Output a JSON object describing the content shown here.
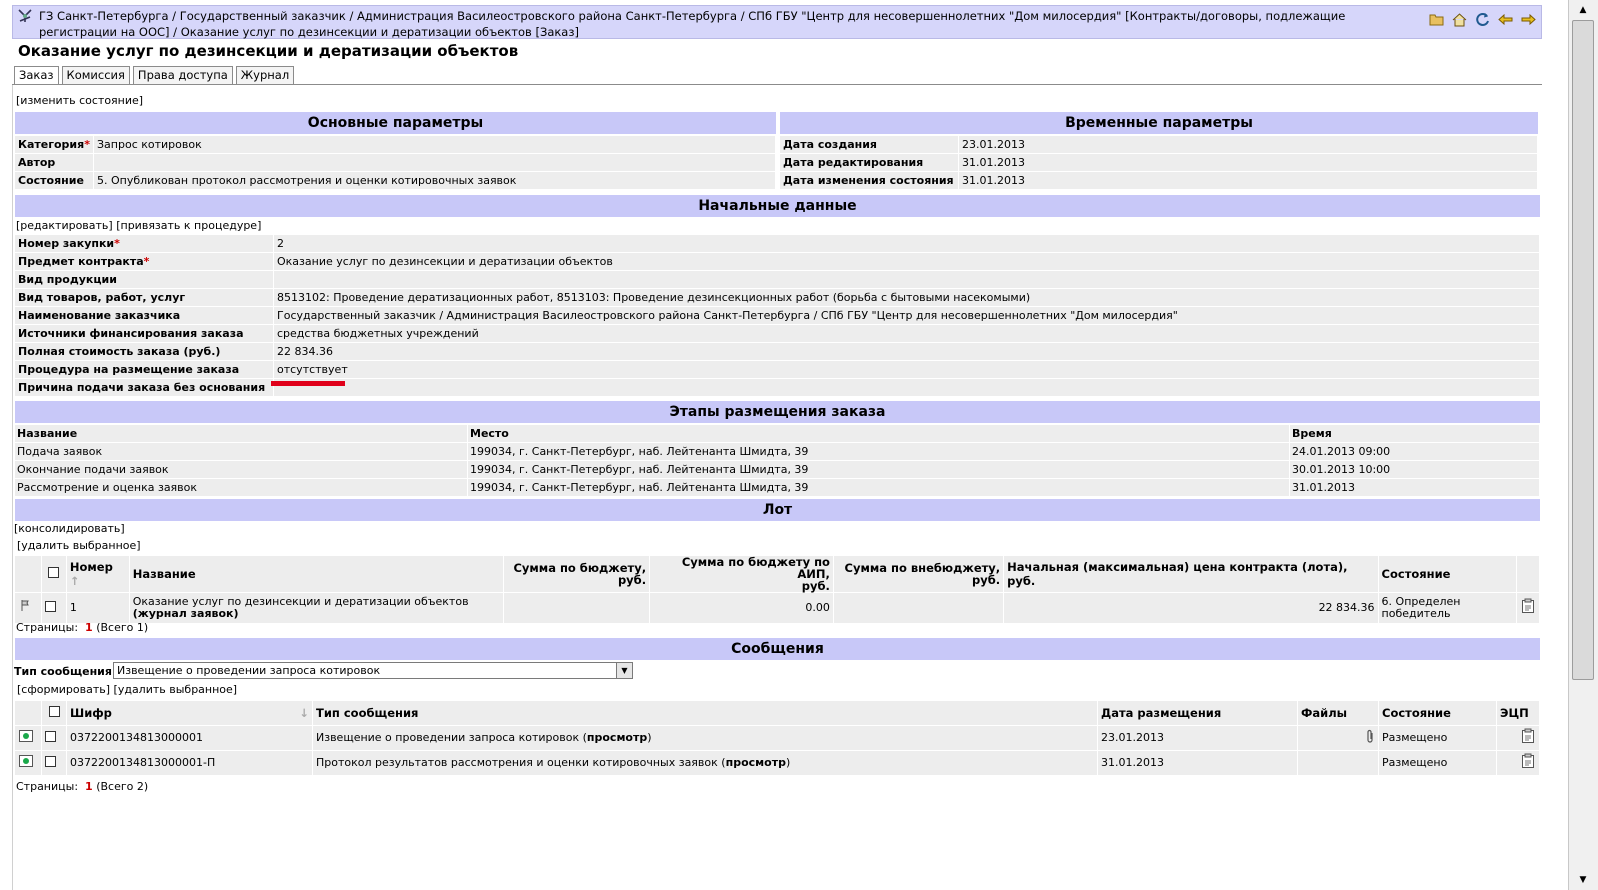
{
  "header": {
    "breadcrumb": "ГЗ Санкт-Петербурга / Государственный заказчик / Администрация Василеостровского района Санкт-Петербурга / СПб ГБУ \"Центр для несовершеннолетних \"Дом милосердия\" [Контракты/договоры, подлежащие регистрации на ООС] / Оказание услуг по дезинсекции и дератизации объектов [Заказ]",
    "tools": [
      "folder-icon",
      "home-icon",
      "refresh-icon",
      "back-icon",
      "forward-icon"
    ]
  },
  "page_title": "Оказание услуг по дезинсекции и дератизации объектов",
  "tabs": [
    {
      "label": "Заказ",
      "active": true
    },
    {
      "label": "Комиссия",
      "active": false
    },
    {
      "label": "Права доступа",
      "active": false
    },
    {
      "label": "Журнал",
      "active": false
    }
  ],
  "change_state_link": "[изменить состояние]",
  "main_params": {
    "title": "Основные параметры",
    "rows": [
      {
        "label": "Категория",
        "required": "*",
        "value": "Запрос котировок"
      },
      {
        "label": "Автор",
        "required": "",
        "value": ""
      },
      {
        "label": "Состояние",
        "required": "",
        "value": "5. Опубликован протокол рассмотрения и оценки котировочных заявок"
      }
    ]
  },
  "time_params": {
    "title": "Временные параметры",
    "rows": [
      {
        "label": "Дата создания",
        "value": "23.01.2013"
      },
      {
        "label": "Дата редактирования",
        "value": "31.01.2013"
      },
      {
        "label": "Дата изменения состояния",
        "value": "31.01.2013"
      }
    ]
  },
  "initial": {
    "title": "Начальные данные",
    "edit_link": "[редактировать]",
    "bind_link": "[привязать к процедуре]",
    "rows": [
      {
        "label": "Номер закупки",
        "required": "*",
        "value": "2"
      },
      {
        "label": "Предмет контракта",
        "required": "*",
        "value": "Оказание услуг по дезинсекции и дератизации объектов"
      },
      {
        "label": "Вид продукции",
        "required": "",
        "value": ""
      },
      {
        "label": "Вид товаров, работ, услуг",
        "required": "",
        "value": "8513102: Проведение дератизационных работ, 8513103: Проведение дезинсекционных работ (борьба с бытовыми насекомыми)"
      },
      {
        "label": "Наименование заказчика",
        "required": "",
        "value": "Государственный заказчик / Администрация Василеостровского района Санкт-Петербурга / СПб ГБУ \"Центр для несовершеннолетних \"Дом милосердия\""
      },
      {
        "label": "Источники финансирования заказа",
        "required": "",
        "value": "средства бюджетных учреждений"
      },
      {
        "label": "Полная стоимость заказа (руб.)",
        "required": "",
        "value": "22 834.36"
      },
      {
        "label": "Процедура на размещение заказа",
        "required": "",
        "value": "отсутствует"
      },
      {
        "label": "Причина подачи заказа без основания",
        "required": "",
        "value": ""
      }
    ]
  },
  "stages": {
    "title": "Этапы размещения заказа",
    "columns": [
      "Название",
      "Место",
      "Время"
    ],
    "rows": [
      [
        "Подача заявок",
        "199034, г. Санкт-Петербург, наб. Лейтенанта Шмидта, 39",
        "24.01.2013 09:00"
      ],
      [
        "Окончание подачи заявок",
        "199034, г. Санкт-Петербург, наб. Лейтенанта Шмидта, 39",
        "30.01.2013 10:00"
      ],
      [
        "Рассмотрение и оценка заявок",
        "199034, г. Санкт-Петербург, наб. Лейтенанта Шмидта, 39",
        "31.01.2013"
      ]
    ]
  },
  "lot": {
    "title": "Лот",
    "consolidate_link": "[консолидировать]",
    "delete_link": "[удалить выбранное]",
    "columns": {
      "num": "Номер",
      "name": "Название",
      "budget_l1": "Сумма по бюджету,",
      "budget_l2": "руб.",
      "aip_l1": "Сумма по бюджету по АИП,",
      "aip_l2": "руб.",
      "extra_l1": "Сумма по внебюджету,",
      "extra_l2": "руб.",
      "price": "Начальная (максимальная) цена контракта (лота), руб.",
      "state": "Состояние"
    },
    "row": {
      "num": "1",
      "name": "Оказание услуг по дезинсекции и дератизации объектов",
      "journal": "(журнал заявок)",
      "budget": "",
      "aip": "0.00",
      "extra": "",
      "price": "22 834.36",
      "state_l1": "6. Определен",
      "state_l2": "победитель"
    },
    "pager_label": "Страницы:",
    "pager_current": "1",
    "pager_total": "(Всего 1)"
  },
  "messages": {
    "title": "Сообщения",
    "type_label": "Тип сообщения",
    "type_value": "Извещение о проведении запроса котировок",
    "form_link": "[сформировать]",
    "delete_link": "[удалить выбранное]",
    "columns": [
      "Шифр",
      "Тип сообщения",
      "Дата размещения",
      "Файлы",
      "Состояние",
      "ЭЦП"
    ],
    "rows": [
      {
        "code": "0372200134813000001",
        "type": "Извещение о проведении запроса котировок",
        "view": "просмотр",
        "date": "23.01.2013",
        "files": "attach",
        "state": "Размещено"
      },
      {
        "code": "0372200134813000001-П",
        "type": "Протокол результатов рассмотрения и оценки котировочных заявок",
        "view": "просмотр",
        "date": "31.01.2013",
        "files": "",
        "state": "Размещено"
      }
    ],
    "pager_label": "Страницы:",
    "pager_current": "1",
    "pager_total": "(Всего 2)"
  },
  "colors": {
    "section_header": "#c8c8f8",
    "header_bar": "#d6d6fa",
    "row_bg": "#ededed",
    "required": "#cc0000",
    "highlight": "#e0001a"
  }
}
